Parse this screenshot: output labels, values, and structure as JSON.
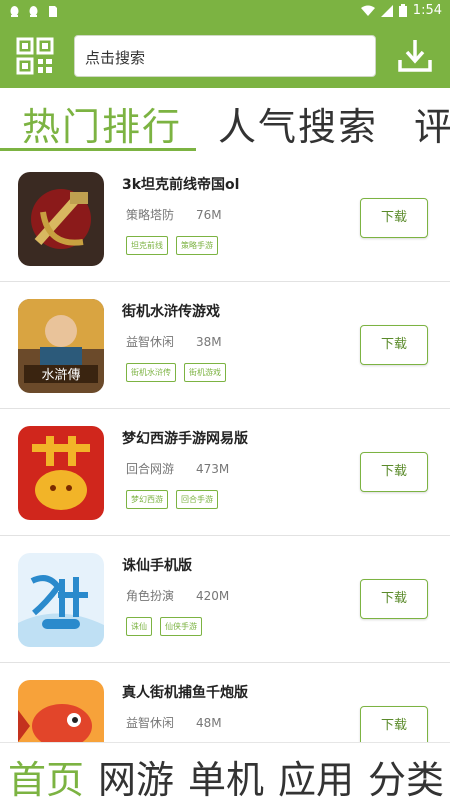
{
  "status_bar": {
    "time": "1:54"
  },
  "header": {
    "search_placeholder": "点击搜索"
  },
  "tabs": [
    "热门排行",
    "人气搜索",
    "评"
  ],
  "apps": [
    {
      "name": "3k坦克前线帝国ol",
      "category": "策略塔防",
      "size": "76M",
      "tags": [
        "坦克前线",
        "策略手游"
      ],
      "button": "下载",
      "icon": "tank-hammer-sickle-icon"
    },
    {
      "name": "街机水浒传游戏",
      "category": "益智休闲",
      "size": "38M",
      "tags": [
        "街机水浒传",
        "街机游戏"
      ],
      "button": "下载",
      "icon": "water-margin-icon"
    },
    {
      "name": "梦幻西游手游网易版",
      "category": "回合网游",
      "size": "473M",
      "tags": [
        "梦幻西游",
        "回合手游"
      ],
      "button": "下载",
      "icon": "dream-character-icon"
    },
    {
      "name": "诛仙手机版",
      "category": "角色扮演",
      "size": "420M",
      "tags": [
        "诛仙",
        "仙侠手游"
      ],
      "button": "下载",
      "icon": "zhuxian-logo-icon"
    },
    {
      "name": "真人街机捕鱼千炮版",
      "category": "益智休闲",
      "size": "48M",
      "tags": [],
      "button": "下载",
      "icon": "goldfish-icon"
    }
  ],
  "bottom_nav": [
    "首页",
    "网游",
    "单机",
    "应用",
    "分类"
  ],
  "colors": {
    "accent": "#7cb342",
    "text": "#222222"
  }
}
